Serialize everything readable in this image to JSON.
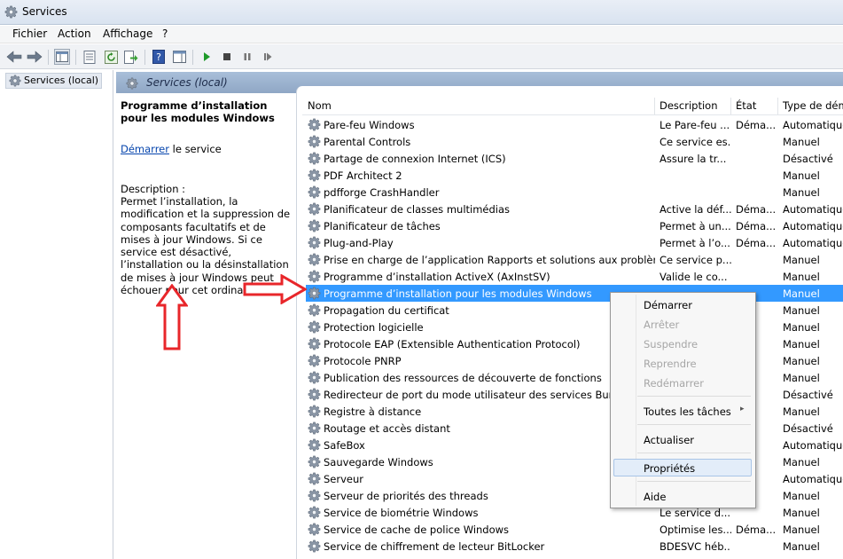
{
  "window": {
    "title": "Services"
  },
  "menu": {
    "file": "Fichier",
    "action": "Action",
    "view": "Affichage",
    "help": "?"
  },
  "tree": {
    "root": "Services (local)"
  },
  "header": {
    "title": "Services (local)"
  },
  "detail": {
    "service_title": "Programme d’installation pour les modules Windows",
    "start_link": "Démarrer",
    "start_suffix": " le service",
    "description_label": "Description :",
    "description_text": "Permet l’installation, la modification et la suppression de composants facultatifs et de mises à jour Windows. Si ce service est désactivé, l’installation ou la désinstallation de mises à jour Windows peut échouer pour cet ordinateur."
  },
  "columns": {
    "name": "Nom",
    "description": "Description",
    "state": "État",
    "startup": "Type de démarrage"
  },
  "services": [
    {
      "name": "Pare-feu Windows",
      "description": "Le Pare-feu ...",
      "state": "Déma...",
      "startup": "Automatique"
    },
    {
      "name": "Parental Controls",
      "description": "Ce service es...",
      "state": "",
      "startup": "Manuel"
    },
    {
      "name": "Partage de connexion Internet (ICS)",
      "description": "Assure la tr...",
      "state": "",
      "startup": "Désactivé"
    },
    {
      "name": "PDF Architect 2",
      "description": "",
      "state": "",
      "startup": "Manuel"
    },
    {
      "name": "pdfforge CrashHandler",
      "description": "",
      "state": "",
      "startup": "Manuel"
    },
    {
      "name": "Planificateur de classes multimédias",
      "description": "Active la déf...",
      "state": "Déma...",
      "startup": "Automatique"
    },
    {
      "name": "Planificateur de tâches",
      "description": "Permet à un...",
      "state": "Déma...",
      "startup": "Automatique"
    },
    {
      "name": "Plug-and-Play",
      "description": "Permet à l’o...",
      "state": "Déma...",
      "startup": "Automatique"
    },
    {
      "name": "Prise en charge de l’application Rapports et solutions aux problèmes du...",
      "description": "Ce service p...",
      "state": "",
      "startup": "Manuel"
    },
    {
      "name": "Programme d’installation ActiveX (AxInstSV)",
      "description": "Valide le co...",
      "state": "",
      "startup": "Manuel"
    },
    {
      "name": "Programme d’installation pour les modules Windows",
      "description": "",
      "state": "",
      "startup": "Manuel"
    },
    {
      "name": "Propagation du certificat",
      "description": "",
      "state": "",
      "startup": "Manuel"
    },
    {
      "name": "Protection logicielle",
      "description": "",
      "state": "",
      "startup": "Manuel"
    },
    {
      "name": "Protocole EAP (Extensible Authentication Protocol)",
      "description": "",
      "state": "",
      "startup": "Manuel"
    },
    {
      "name": "Protocole PNRP",
      "description": "",
      "state": "",
      "startup": "Manuel"
    },
    {
      "name": "Publication des ressources de découverte de fonctions",
      "description": "",
      "state": "",
      "startup": "Manuel"
    },
    {
      "name": "Redirecteur de port du mode utilisateur des services Bureau à distance",
      "description": "",
      "state": "",
      "startup": "Désactivé"
    },
    {
      "name": "Registre à distance",
      "description": "",
      "state": "",
      "startup": "Manuel"
    },
    {
      "name": "Routage et accès distant",
      "description": "",
      "state": "",
      "startup": "Désactivé"
    },
    {
      "name": "SafeBox",
      "description": "",
      "state": "",
      "startup": "Automatique"
    },
    {
      "name": "Sauvegarde Windows",
      "description": "",
      "state": "",
      "startup": "Manuel"
    },
    {
      "name": "Serveur",
      "description": "",
      "state": "",
      "startup": "Automatique"
    },
    {
      "name": "Serveur de priorités des threads",
      "description": "",
      "state": "",
      "startup": "Manuel"
    },
    {
      "name": "Service de biométrie Windows",
      "description": "Le service d...",
      "state": "",
      "startup": "Manuel"
    },
    {
      "name": "Service de cache de police Windows",
      "description": "Optimise les...",
      "state": "Déma...",
      "startup": "Manuel"
    },
    {
      "name": "Service de chiffrement de lecteur BitLocker",
      "description": "BDESVC héb...",
      "state": "",
      "startup": "Manuel"
    }
  ],
  "selected_index": 10,
  "context_menu": {
    "start": "Démarrer",
    "stop": "Arrêter",
    "pause": "Suspendre",
    "resume": "Reprendre",
    "restart": "Redémarrer",
    "all_tasks": "Toutes les tâches",
    "refresh": "Actualiser",
    "properties": "Propriétés",
    "help": "Aide"
  },
  "colors": {
    "selection": "#3399ff",
    "annotation_arrow": "#e8262a",
    "header_band": "#9fb6d2",
    "link": "#0645ad"
  }
}
